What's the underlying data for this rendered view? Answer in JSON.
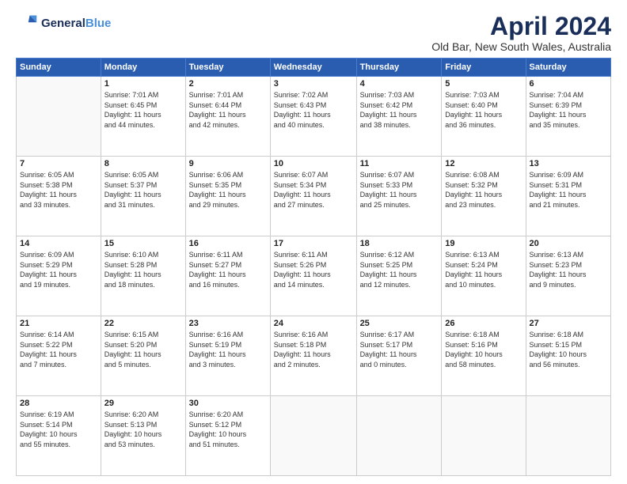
{
  "logo": {
    "line1": "General",
    "line2": "Blue"
  },
  "title": "April 2024",
  "subtitle": "Old Bar, New South Wales, Australia",
  "days_header": [
    "Sunday",
    "Monday",
    "Tuesday",
    "Wednesday",
    "Thursday",
    "Friday",
    "Saturday"
  ],
  "weeks": [
    [
      {
        "num": "",
        "info": ""
      },
      {
        "num": "1",
        "info": "Sunrise: 7:01 AM\nSunset: 6:45 PM\nDaylight: 11 hours\nand 44 minutes."
      },
      {
        "num": "2",
        "info": "Sunrise: 7:01 AM\nSunset: 6:44 PM\nDaylight: 11 hours\nand 42 minutes."
      },
      {
        "num": "3",
        "info": "Sunrise: 7:02 AM\nSunset: 6:43 PM\nDaylight: 11 hours\nand 40 minutes."
      },
      {
        "num": "4",
        "info": "Sunrise: 7:03 AM\nSunset: 6:42 PM\nDaylight: 11 hours\nand 38 minutes."
      },
      {
        "num": "5",
        "info": "Sunrise: 7:03 AM\nSunset: 6:40 PM\nDaylight: 11 hours\nand 36 minutes."
      },
      {
        "num": "6",
        "info": "Sunrise: 7:04 AM\nSunset: 6:39 PM\nDaylight: 11 hours\nand 35 minutes."
      }
    ],
    [
      {
        "num": "7",
        "info": "Sunrise: 6:05 AM\nSunset: 5:38 PM\nDaylight: 11 hours\nand 33 minutes."
      },
      {
        "num": "8",
        "info": "Sunrise: 6:05 AM\nSunset: 5:37 PM\nDaylight: 11 hours\nand 31 minutes."
      },
      {
        "num": "9",
        "info": "Sunrise: 6:06 AM\nSunset: 5:35 PM\nDaylight: 11 hours\nand 29 minutes."
      },
      {
        "num": "10",
        "info": "Sunrise: 6:07 AM\nSunset: 5:34 PM\nDaylight: 11 hours\nand 27 minutes."
      },
      {
        "num": "11",
        "info": "Sunrise: 6:07 AM\nSunset: 5:33 PM\nDaylight: 11 hours\nand 25 minutes."
      },
      {
        "num": "12",
        "info": "Sunrise: 6:08 AM\nSunset: 5:32 PM\nDaylight: 11 hours\nand 23 minutes."
      },
      {
        "num": "13",
        "info": "Sunrise: 6:09 AM\nSunset: 5:31 PM\nDaylight: 11 hours\nand 21 minutes."
      }
    ],
    [
      {
        "num": "14",
        "info": "Sunrise: 6:09 AM\nSunset: 5:29 PM\nDaylight: 11 hours\nand 19 minutes."
      },
      {
        "num": "15",
        "info": "Sunrise: 6:10 AM\nSunset: 5:28 PM\nDaylight: 11 hours\nand 18 minutes."
      },
      {
        "num": "16",
        "info": "Sunrise: 6:11 AM\nSunset: 5:27 PM\nDaylight: 11 hours\nand 16 minutes."
      },
      {
        "num": "17",
        "info": "Sunrise: 6:11 AM\nSunset: 5:26 PM\nDaylight: 11 hours\nand 14 minutes."
      },
      {
        "num": "18",
        "info": "Sunrise: 6:12 AM\nSunset: 5:25 PM\nDaylight: 11 hours\nand 12 minutes."
      },
      {
        "num": "19",
        "info": "Sunrise: 6:13 AM\nSunset: 5:24 PM\nDaylight: 11 hours\nand 10 minutes."
      },
      {
        "num": "20",
        "info": "Sunrise: 6:13 AM\nSunset: 5:23 PM\nDaylight: 11 hours\nand 9 minutes."
      }
    ],
    [
      {
        "num": "21",
        "info": "Sunrise: 6:14 AM\nSunset: 5:22 PM\nDaylight: 11 hours\nand 7 minutes."
      },
      {
        "num": "22",
        "info": "Sunrise: 6:15 AM\nSunset: 5:20 PM\nDaylight: 11 hours\nand 5 minutes."
      },
      {
        "num": "23",
        "info": "Sunrise: 6:16 AM\nSunset: 5:19 PM\nDaylight: 11 hours\nand 3 minutes."
      },
      {
        "num": "24",
        "info": "Sunrise: 6:16 AM\nSunset: 5:18 PM\nDaylight: 11 hours\nand 2 minutes."
      },
      {
        "num": "25",
        "info": "Sunrise: 6:17 AM\nSunset: 5:17 PM\nDaylight: 11 hours\nand 0 minutes."
      },
      {
        "num": "26",
        "info": "Sunrise: 6:18 AM\nSunset: 5:16 PM\nDaylight: 10 hours\nand 58 minutes."
      },
      {
        "num": "27",
        "info": "Sunrise: 6:18 AM\nSunset: 5:15 PM\nDaylight: 10 hours\nand 56 minutes."
      }
    ],
    [
      {
        "num": "28",
        "info": "Sunrise: 6:19 AM\nSunset: 5:14 PM\nDaylight: 10 hours\nand 55 minutes."
      },
      {
        "num": "29",
        "info": "Sunrise: 6:20 AM\nSunset: 5:13 PM\nDaylight: 10 hours\nand 53 minutes."
      },
      {
        "num": "30",
        "info": "Sunrise: 6:20 AM\nSunset: 5:12 PM\nDaylight: 10 hours\nand 51 minutes."
      },
      {
        "num": "",
        "info": ""
      },
      {
        "num": "",
        "info": ""
      },
      {
        "num": "",
        "info": ""
      },
      {
        "num": "",
        "info": ""
      }
    ]
  ]
}
